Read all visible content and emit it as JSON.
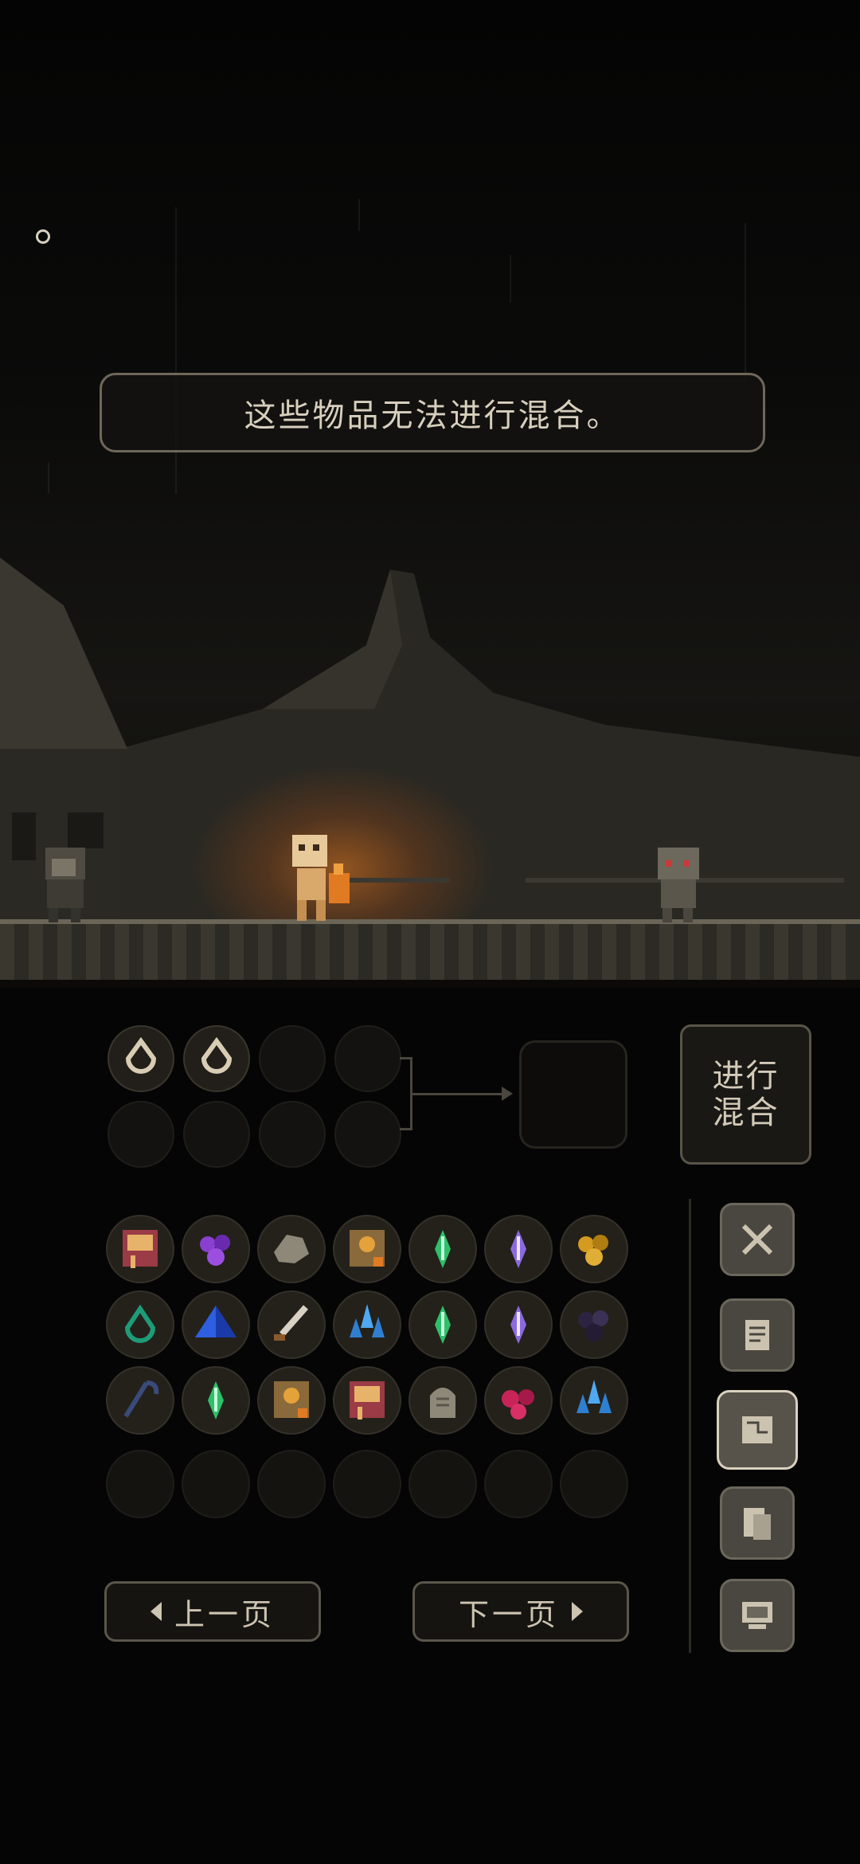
{
  "message": {
    "text": "这些物品无法进行混合。"
  },
  "craft": {
    "mix_button_label": "进行\n混合",
    "input_slots": [
      "drop-ring",
      "drop-ring",
      "",
      "",
      "",
      "",
      "",
      ""
    ]
  },
  "inventory": {
    "rows": [
      [
        "recipe-book",
        "purple-berries",
        "gray-ore",
        "fire-tome",
        "green-crystal",
        "violet-crystal",
        "gold-nuggets"
      ],
      [
        "teal-ring",
        "blue-pyramid",
        "dagger",
        "blue-crystal-cluster",
        "green-crystal",
        "violet-crystal",
        "dark-berries"
      ],
      [
        "cane",
        "green-crystal",
        "fire-tome",
        "recipe-book",
        "tombstone",
        "red-berries",
        "blue-crystal-cluster"
      ],
      [
        "",
        "",
        "",
        "",
        "",
        "",
        ""
      ]
    ]
  },
  "pagination": {
    "prev_label": "上一页",
    "next_label": "下一页"
  },
  "tabs": [
    {
      "icon": "crossed-swords-icon",
      "active": false
    },
    {
      "icon": "scroll-icon",
      "active": false
    },
    {
      "icon": "map-icon",
      "active": true
    },
    {
      "icon": "notes-icon",
      "active": false
    },
    {
      "icon": "computer-icon",
      "active": false
    }
  ],
  "colors": {
    "accent": "#d9d1be",
    "panel_border": "#595448",
    "fire": "#e07a23"
  }
}
